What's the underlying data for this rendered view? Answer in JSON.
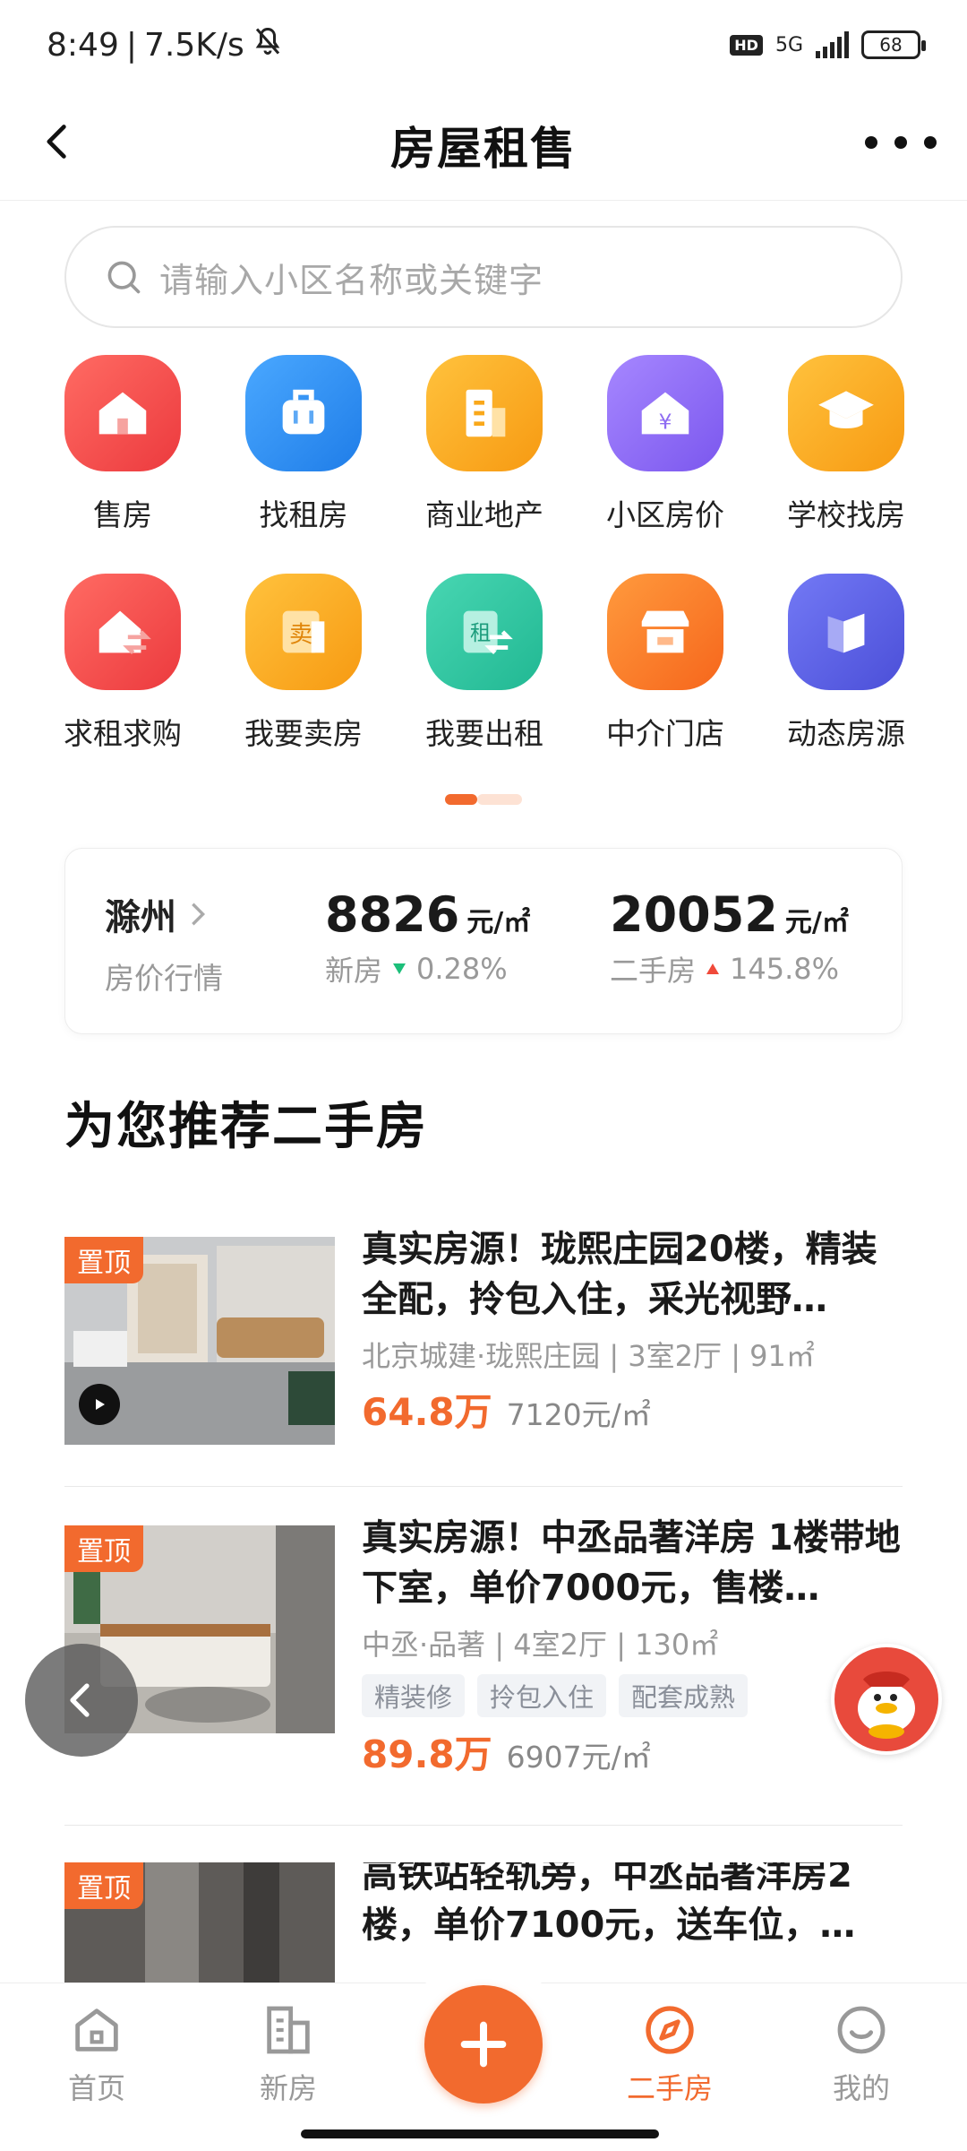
{
  "status_bar": {
    "time": "8:49",
    "speed": "7.5K/s",
    "network": "5G",
    "hd": "HD",
    "battery": "68"
  },
  "nav": {
    "title": "房屋租售"
  },
  "search": {
    "placeholder": "请输入小区名称或关键字"
  },
  "grid": {
    "row1": [
      {
        "label": "售房",
        "icon": "house-icon",
        "color": "#f0474a"
      },
      {
        "label": "找租房",
        "icon": "suitcase-icon",
        "color": "#2f8ff5"
      },
      {
        "label": "商业地产",
        "icon": "building-icon",
        "color": "#f9a81a"
      },
      {
        "label": "小区房价",
        "icon": "yen-house-icon",
        "color": "#8e6cf2"
      },
      {
        "label": "学校找房",
        "icon": "graduation-cap-icon",
        "color": "#f9a81a"
      }
    ],
    "row2": [
      {
        "label": "求租求购",
        "icon": "house-exchange-icon",
        "color": "#f0474a"
      },
      {
        "label": "我要卖房",
        "icon": "sell-icon",
        "color": "#f9a81a"
      },
      {
        "label": "我要出租",
        "icon": "rent-icon",
        "color": "#2ec4a0"
      },
      {
        "label": "中介门店",
        "icon": "store-icon",
        "color": "#fa7d2c"
      },
      {
        "label": "动态房源",
        "icon": "flag-icon",
        "color": "#5b5fe6"
      }
    ],
    "sell_glyph": "卖",
    "rent_glyph": "租",
    "yen_glyph": "¥"
  },
  "price_card": {
    "city": "滁州",
    "subtitle": "房价行情",
    "new": {
      "value": "8826",
      "unit": "元/㎡",
      "label": "新房",
      "change": "0.28%"
    },
    "used": {
      "value": "20052",
      "unit": "元/㎡",
      "label": "二手房",
      "change": "145.8%"
    }
  },
  "section_title": "为您推荐二手房",
  "listings": [
    {
      "tag": "置顶",
      "title": "真实房源！珑熙庄园20楼，精装全配，拎包入住，采光视野…",
      "meta": "北京城建·珑熙庄园 | 3室2厅 | 91㎡",
      "chips": [],
      "price": "64.8万",
      "unit_price": "7120元/㎡"
    },
    {
      "tag": "置顶",
      "title": "真实房源！中丞品著洋房 1楼带地下室，单价7000元，售楼…",
      "meta": "中丞·品著 | 4室2厅 | 130㎡",
      "chips": [
        "精装修",
        "拎包入住",
        "配套成熟"
      ],
      "price": "89.8万",
      "unit_price": "6907元/㎡"
    },
    {
      "tag": "置顶",
      "title": "高铁站轻轨旁，中丞品著洋房2楼，单价7100元，送车位，…",
      "meta": "",
      "chips": [],
      "price": "",
      "unit_price": ""
    }
  ],
  "tabbar": {
    "home": "首页",
    "new_house": "新房",
    "used_house": "二手房",
    "mine": "我的"
  },
  "colors": {
    "accent": "#f26a2e",
    "down": "#1cbf7a",
    "up": "#f04a3a"
  }
}
